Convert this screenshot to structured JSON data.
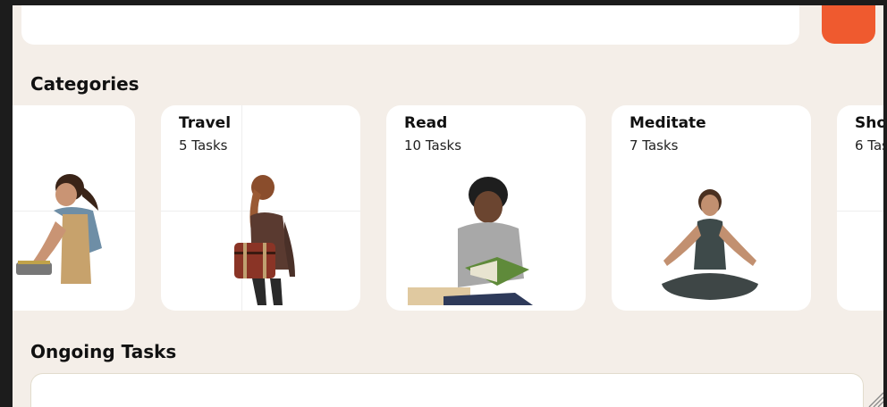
{
  "header": {
    "search_placeholder": "",
    "action_color": "#ef5a2f"
  },
  "categories": {
    "title": "Categories",
    "items": [
      {
        "name": "",
        "count": "",
        "illustration": "girl-cooking"
      },
      {
        "name": "Travel",
        "count": "5 Tasks",
        "illustration": "woman-with-suitcase"
      },
      {
        "name": "Read",
        "count": "10 Tasks",
        "illustration": "boy-reading-book"
      },
      {
        "name": "Meditate",
        "count": "7 Tasks",
        "illustration": "woman-meditating"
      },
      {
        "name": "Sho",
        "count": "6 Tas",
        "illustration": ""
      }
    ]
  },
  "ongoing": {
    "title": "Ongoing Tasks"
  }
}
